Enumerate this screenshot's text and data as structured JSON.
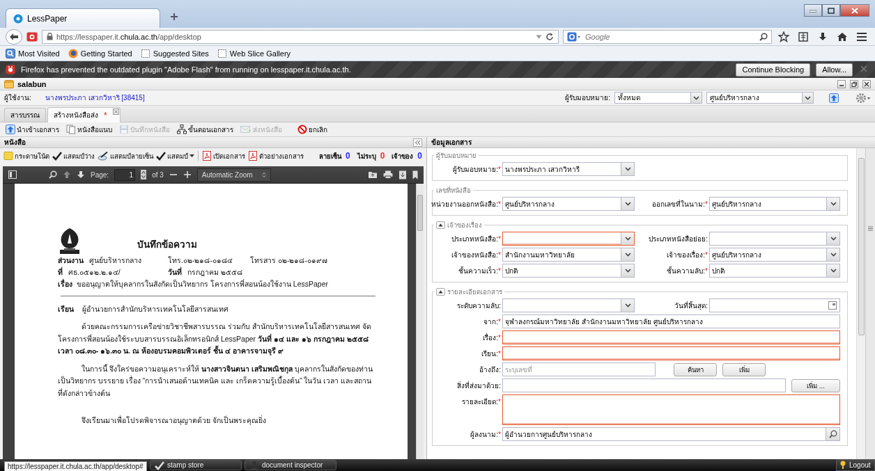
{
  "browser": {
    "tab_title": "LessPaper",
    "url": "https://lesspaper.it.**chula.ac.th**/app/desktop",
    "search_placeholder": "Google",
    "bookmarks": [
      {
        "label": "Most Visited",
        "kind": "bookmarks"
      },
      {
        "label": "Getting Started",
        "kind": "globe"
      },
      {
        "label": "Suggested Sites",
        "kind": "page"
      },
      {
        "label": "Web Slice Gallery",
        "kind": "page"
      }
    ],
    "notification": {
      "message": "Firefox has prevented the outdated plugin \"Adobe Flash\" from running on lesspaper.it.chula.ac.th.",
      "buttons": [
        "Continue Blocking",
        "Allow..."
      ]
    }
  },
  "app": {
    "title": "salabun",
    "user_label": "ผู้ใช้งาน:",
    "user_name": "นางพรประภา เสวกวิหาริ [38415]",
    "assignee_label": "ผู้รับมอบหมาย:",
    "assignee_filter": "ทั้งหมด",
    "unit_filter": "ศูนย์บริหารกลาง",
    "tabs": [
      {
        "label": "สารบรรณ",
        "selected": false,
        "closable": false
      },
      {
        "label": "สร้างหนังสือส่ง",
        "selected": true,
        "closable": true,
        "modified_mark": "*"
      }
    ],
    "toolbar": [
      {
        "label": "นำเข้าเอกสาร",
        "kind": "upload",
        "disabled": false
      },
      {
        "label": "หนังสือแนบ",
        "kind": "pages",
        "disabled": false
      },
      {
        "label": "บันทึกหนังสือ",
        "kind": "floppy",
        "disabled": true
      },
      {
        "label": "ขั้นตอนเอกสาร",
        "kind": "hierarchy",
        "disabled": false
      },
      {
        "label": "ส่งหนังสือ",
        "kind": "envelope",
        "disabled": true
      },
      {
        "label": "ยกเลิก",
        "kind": "no-entry",
        "disabled": false
      }
    ]
  },
  "document_panel": {
    "title": "หนังสือ",
    "toolbar": [
      {
        "label": "กระดาษโน้ต",
        "kind": "note",
        "dropdown": false
      },
      {
        "label": "แสตมป์ว่าง",
        "kind": "check",
        "dropdown": false
      },
      {
        "label": "แสตมป์ลายเซ็น",
        "kind": "pen",
        "dropdown": false
      },
      {
        "label": "แสตมป์",
        "kind": "check",
        "dropdown": true
      },
      {
        "label": "เปิดเอกสาร",
        "kind": "pdf",
        "dropdown": false
      },
      {
        "label": "ตัวอย่างเอกสาร",
        "kind": "pdf",
        "dropdown": false
      }
    ],
    "counters": [
      {
        "label": "ลายเซ็น",
        "value": "0",
        "color": "#2a2aff"
      },
      {
        "label": "ไม่ระบุ",
        "value": "0",
        "color": "#ff2a2a"
      },
      {
        "label": "เจ้าของ",
        "value": "0",
        "color": "#2a2aff"
      }
    ],
    "viewer": {
      "page_label": "Page:",
      "page": "1",
      "page_count": "of 3",
      "zoom": "Automatic Zoom"
    },
    "letter": {
      "heading": "บันทึกข้อความ",
      "header_lines": [
        [
          {
            "label": "ส่วนงาน",
            "value": "ศูนย์บริหารกลาง"
          },
          {
            "value": "โทร.๐๒-๒๑๘-๐๑๘๔"
          },
          {
            "value": "โทรสาร ๐๒-๒๑๘-๐๑๙๗"
          }
        ],
        [
          {
            "label": "ที่",
            "value": "ศธ.๐๕๑๒.๒.๑๔/"
          },
          {
            "label": "วันที่",
            "value": "กรกฎาคม ๒๕๕๘"
          }
        ]
      ],
      "subject": {
        "label": "เรื่อง",
        "value": "ขออนุญาตให้บุคลากรในสังกัดเป็นวิทยากร โครงการพี่สอนน้องใช้งาน LessPaper"
      },
      "salutation": {
        "label": "เรียน",
        "value": "ผู้อำนวยการสำนักบริหารเทคโนโลยีสารสนเทศ"
      },
      "paragraphs": [
        "ด้วยคณะกรรมการเครือข่ายวิชาชีพสารบรรณ ร่วมกับ สำนักบริหารเทคโนโลยีสารสนเทศ จัดโครงการพี่สอนน้องใช้ระบบสารบรรณอิเล็กทรอนิกส์ LessPaper **วันที่ ๑๔ และ ๑๖ กรกฎาคม ๒๕๕๘ เวลา ๐๘.๓๐- ๑๖.๓๐ น. ณ ห้องอบรมคอมพิวเตอร์ ชั้น ๔ อาคารจามจุรี ๙**",
        "ในการนี้ จึงใคร่ขอความอนุเคราะห์ให้ **นางสาวจินตนา เสริมพณิชกุล** บุคลากรในสังกัดของท่านเป็นวิทยากร บรรยาย เรื่อง “การนำเสนอด้านเทคนิค และ เกร็ดความรู้เบื้องต้น” ในวัน เวลา และสถานที่ดังกล่าวข้างต้น",
        "จึงเรียนมาเพื่อโปรดพิจารณาอนุญาตด้วย จักเป็นพระคุณยิ่ง"
      ]
    }
  },
  "form_panel": {
    "title": "ข้อมูลเอกสาร",
    "sections": [
      {
        "legend": "ผู้รับมอบหมาย",
        "kind": "plain",
        "rows": [
          [
            {
              "label": "ผู้รับมอบหมาย:",
              "required_mark": "*",
              "kind": "select",
              "value": "นางพรประภา เสวกวิหารี",
              "invalid": false
            }
          ]
        ]
      },
      {
        "legend": "เลขที่หนังสือ",
        "kind": "plain",
        "rows": [
          [
            {
              "label": "หน่วยงานออกหนังสือ:",
              "required_mark": "*",
              "kind": "select",
              "value": "ศูนย์บริหารกลาง",
              "invalid": false
            },
            {
              "label": "ออกเลขที่ในนาม:",
              "required_mark": "*",
              "kind": "select",
              "value": "ศูนย์บริหารกลาง",
              "invalid": false
            }
          ]
        ]
      },
      {
        "legend": "เจ้าของเรื่อง",
        "kind": "collapsible",
        "expanded": true,
        "rows": [
          [
            {
              "label": "ประเภทหนังสือ:",
              "required_mark": "*",
              "kind": "select",
              "invalid": true
            },
            {
              "label": "ประเภทหนังสือย่อย:",
              "kind": "select",
              "invalid": false
            }
          ],
          [
            {
              "label": "เจ้าของหนังสือ:",
              "required_mark": "*",
              "kind": "select",
              "value": "สำนักงานมหาวิทยาลัย",
              "invalid": false
            },
            {
              "label": "เจ้าของเรื่อง:",
              "required_mark": "*",
              "kind": "select",
              "value": "ศูนย์บริหารกลาง",
              "invalid": false
            }
          ],
          [
            {
              "label": "ชั้นความเร็ว:",
              "required_mark": "*",
              "kind": "select",
              "value": "ปกติ",
              "invalid": false
            },
            {
              "label": "ชั้นความลับ:",
              "required_mark": "*",
              "kind": "select",
              "value": "ปกติ",
              "invalid": false
            }
          ]
        ]
      },
      {
        "legend": "รายละเอียดเอกสาร",
        "kind": "collapsible",
        "expanded": true,
        "rows": [
          [
            {
              "label": "ระดับความลับ:",
              "kind": "select",
              "invalid": false
            },
            {
              "label": "วันที่สิ้นสุด:",
              "kind": "date",
              "invalid": false
            }
          ],
          [
            {
              "label": "จาก:",
              "required_mark": "*",
              "kind": "text",
              "value": "จุฬาลงกรณ์มหาวิทยาลัย สำนักงานมหาวิทยาลัย ศูนย์บริหารกลาง",
              "invalid": false
            }
          ],
          [
            {
              "label": "เรื่อง:",
              "required_mark": "*",
              "kind": "text",
              "invalid": true
            }
          ],
          [
            {
              "label": "เรียน:",
              "required_mark": "*",
              "kind": "text",
              "invalid": true
            }
          ],
          [
            {
              "label": "อ้างถึง:",
              "kind": "text",
              "placeholder": "ระบุเลขที่",
              "invalid": false,
              "buttons": [
                "ค้นหา",
                "เพิ่ม"
              ]
            }
          ],
          [
            {
              "label": "สิ่งที่ส่งมาด้วย:",
              "kind": "text",
              "invalid": false,
              "buttons": [
                "เพิ่ม ..."
              ]
            }
          ],
          [
            {
              "label": "รายละเอียด:",
              "required_mark": "*",
              "kind": "textarea",
              "invalid": true
            }
          ],
          [
            {
              "label": "ผู้ลงนาม:",
              "required_mark": "*",
              "kind": "lookup",
              "value": "ผู้อำนวยการศูนย์บริหารกลาง",
              "invalid": false
            }
          ]
        ]
      }
    ]
  },
  "taskbar": {
    "status_url": "https://lesspaper.it.chula.ac.th/app/desktop#",
    "items": [
      {
        "label": "stamp store",
        "kind": "check"
      },
      {
        "label": "document inspector",
        "kind": "person"
      }
    ],
    "logout": "Logout"
  }
}
